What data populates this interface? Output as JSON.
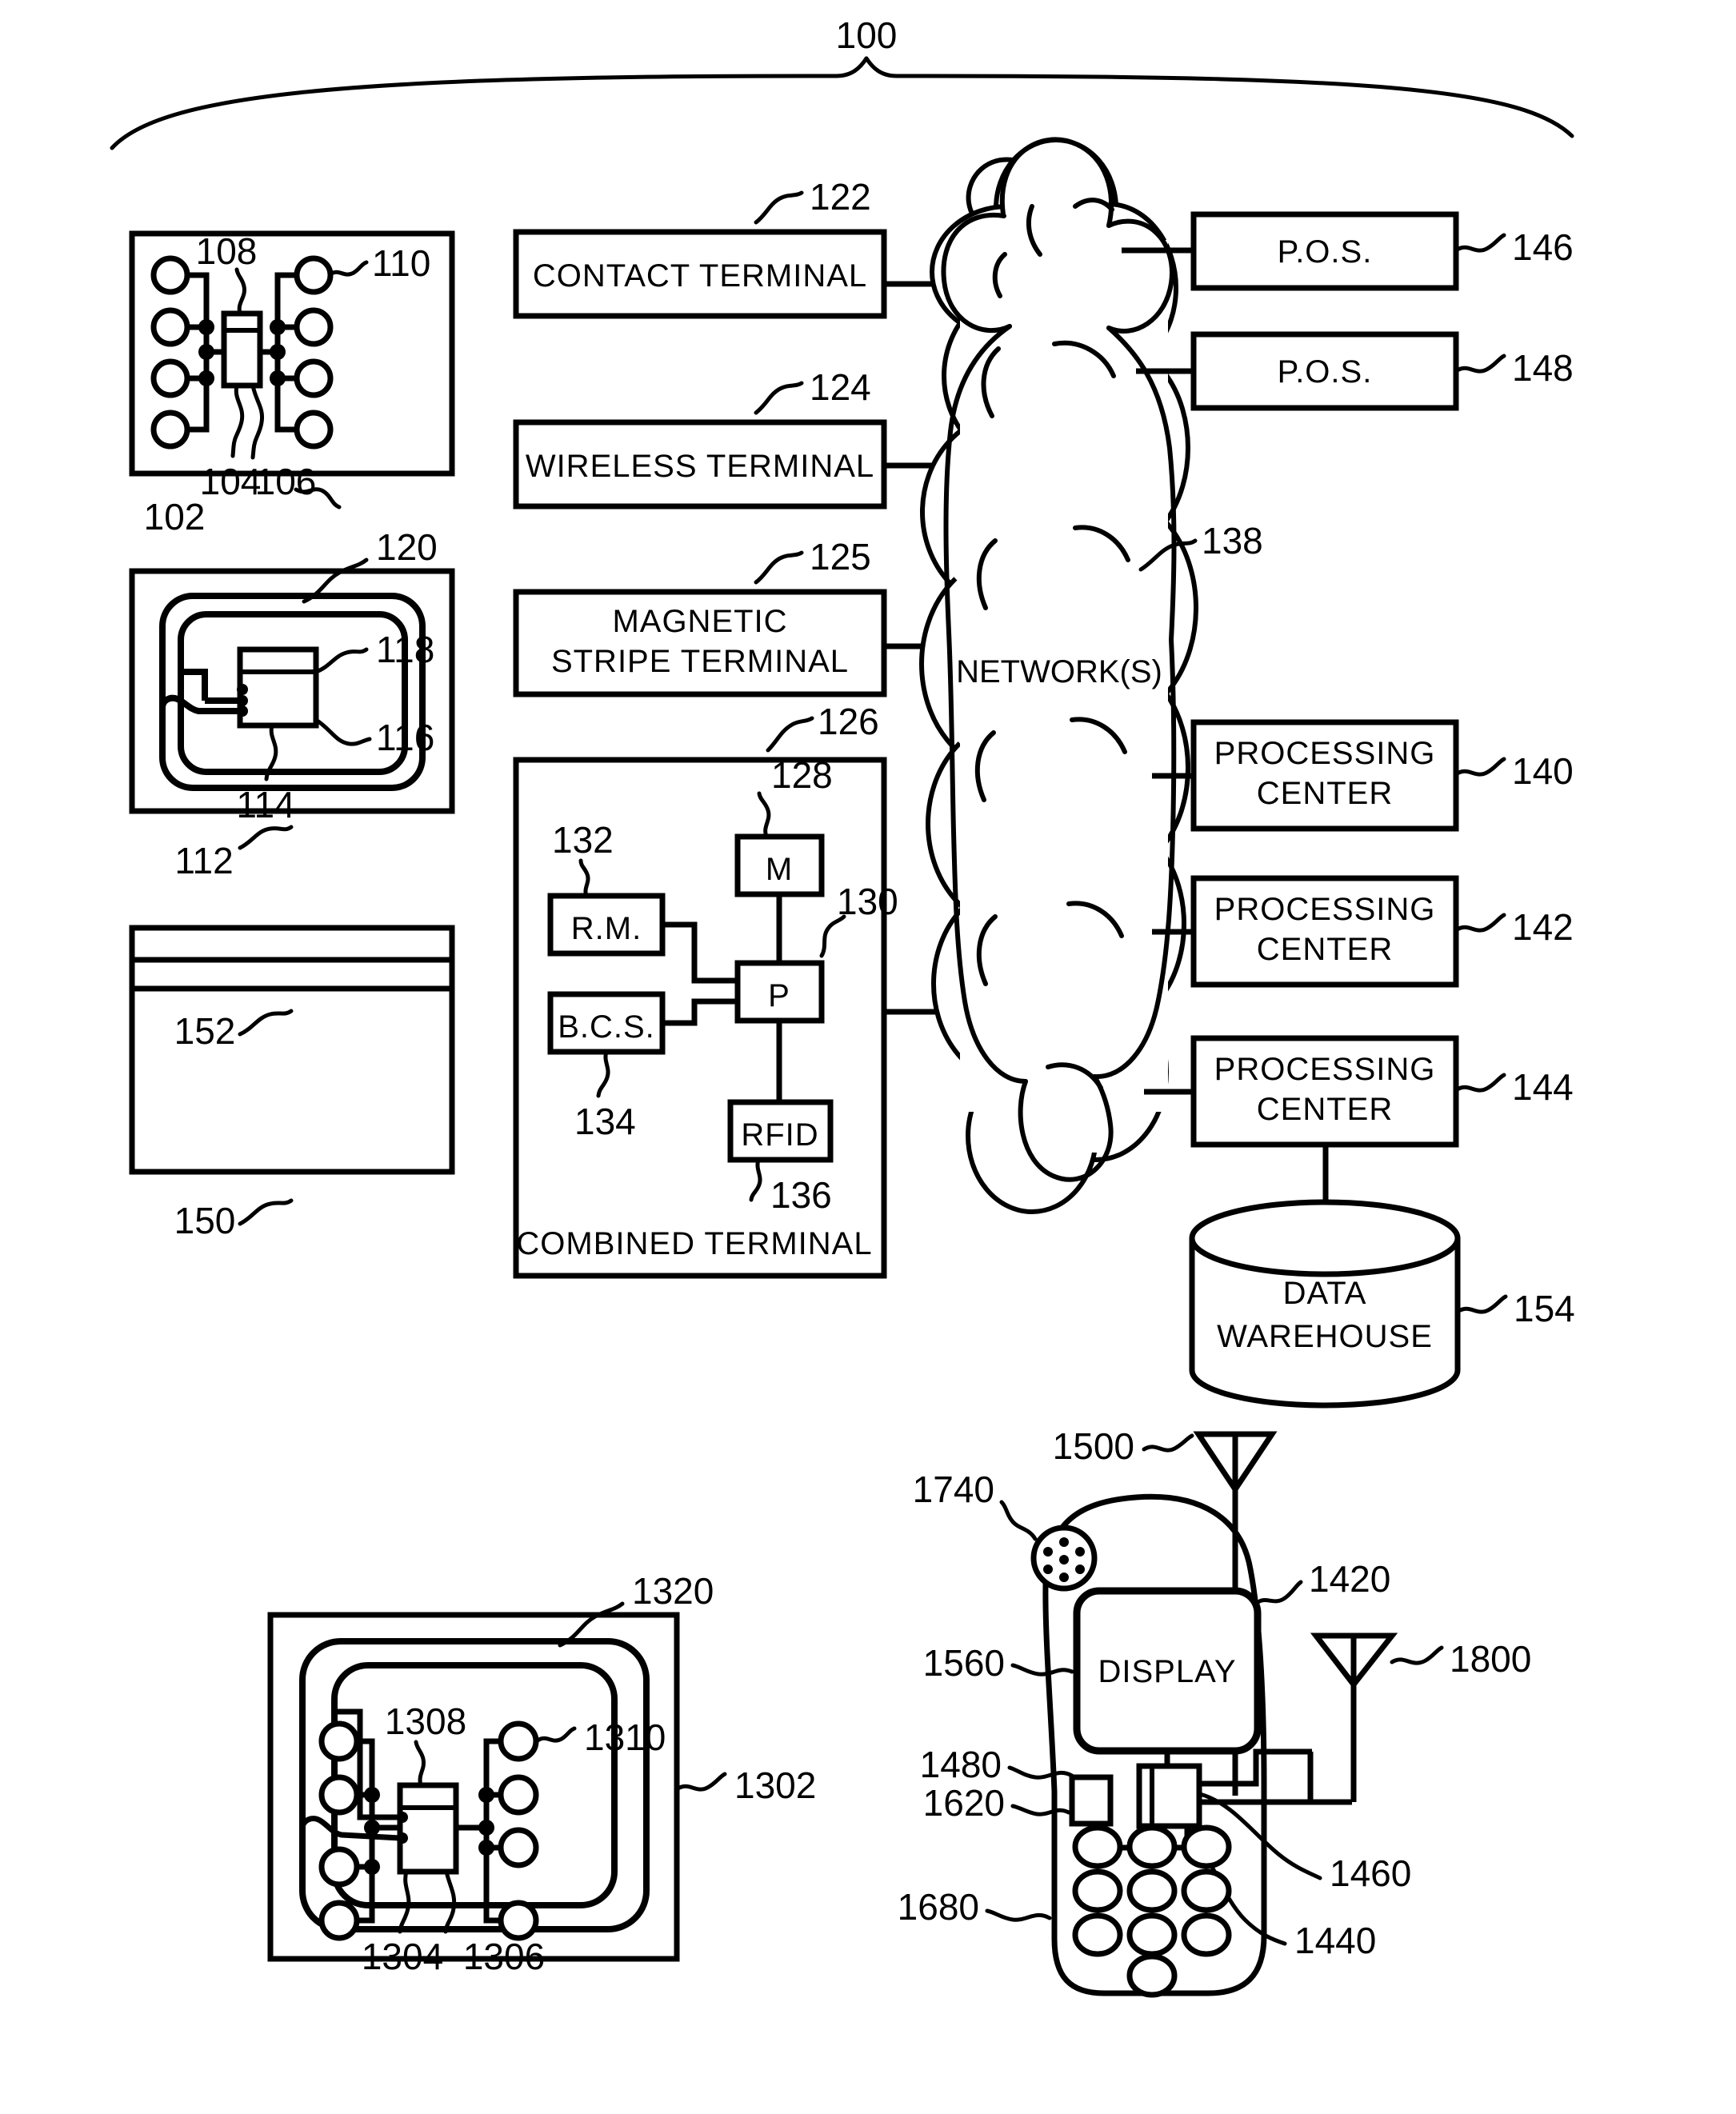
{
  "figure": {
    "system_reference": "100",
    "top_bracket_label": "100"
  },
  "contact_card": {
    "reference": "102",
    "chip_reference": "108",
    "contact_pad_reference": "110",
    "lead_reference_left": "104",
    "lead_reference_right": "106"
  },
  "wireless_card": {
    "reference": "112",
    "antenna_reference": "120",
    "chip_top_reference": "118",
    "chip_bottom_reference": "116",
    "coil_reference": "114"
  },
  "magstripe_card": {
    "reference": "150",
    "stripe_reference": "152"
  },
  "terminals": [
    {
      "label": "CONTACT  TERMINAL",
      "reference": "122",
      "lines": [
        "CONTACT  TERMINAL"
      ]
    },
    {
      "label": "WIRELESS  TERMINAL",
      "reference": "124",
      "lines": [
        "WIRELESS  TERMINAL"
      ]
    },
    {
      "label": "MAGNETIC STRIPE  TERMINAL",
      "reference": "125",
      "lines": [
        "MAGNETIC",
        "STRIPE  TERMINAL"
      ]
    }
  ],
  "combined_terminal": {
    "reference": "126",
    "caption": "COMBINED  TERMINAL",
    "modules": [
      {
        "label": "M",
        "reference": "128"
      },
      {
        "label": "P",
        "reference": "130"
      },
      {
        "label": "R.M.",
        "reference": "132"
      },
      {
        "label": "B.C.S.",
        "reference": "134"
      },
      {
        "label": "RFID",
        "reference": "136"
      }
    ]
  },
  "network": {
    "label": "NETWORK(S)",
    "reference": "138"
  },
  "right_nodes": [
    {
      "label": "P.O.S.",
      "reference": "146",
      "lines": [
        "P.O.S."
      ]
    },
    {
      "label": "P.O.S.",
      "reference": "148",
      "lines": [
        "P.O.S."
      ]
    },
    {
      "label": "PROCESSING CENTER",
      "reference": "140",
      "lines": [
        "PROCESSING",
        "CENTER"
      ]
    },
    {
      "label": "PROCESSING CENTER",
      "reference": "142",
      "lines": [
        "PROCESSING",
        "CENTER"
      ]
    },
    {
      "label": "PROCESSING CENTER",
      "reference": "144",
      "lines": [
        "PROCESSING",
        "CENTER"
      ]
    }
  ],
  "data_warehouse": {
    "lines": [
      "DATA",
      "WAREHOUSE"
    ],
    "reference": "154"
  },
  "lower_left_card": {
    "reference": "1302",
    "antenna_reference": "1320",
    "chip_reference": "1308",
    "contact_pad_reference": "1310",
    "lead_reference_left": "1304",
    "lead_reference_right": "1306"
  },
  "mobile_device": {
    "display_label": "DISPLAY",
    "references": {
      "antenna_top": "1500",
      "speaker": "1740",
      "body": "1420",
      "display": "1560",
      "processor": "1480",
      "memory": "1620",
      "second_antenna": "1800",
      "rf_module": "1460",
      "interface": "1440",
      "keypad": "1680"
    }
  },
  "colors": {
    "ink": "#000000",
    "paper": "#ffffff"
  }
}
